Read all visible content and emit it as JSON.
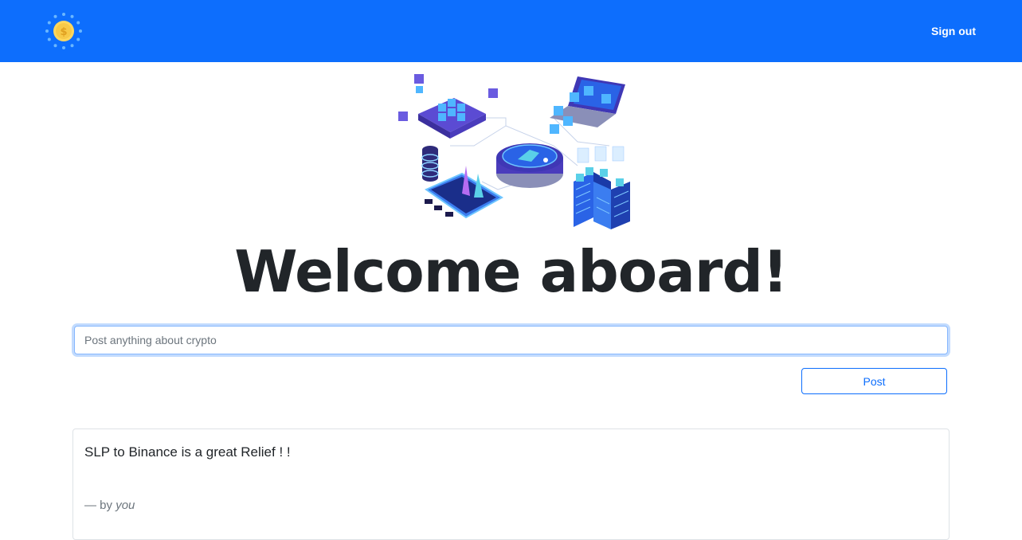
{
  "navbar": {
    "logo_icon": "coin-logo-icon",
    "signout_label": "Sign out",
    "background": "#0d6efd"
  },
  "hero": {
    "image": "blockchain-isometric-illustration",
    "heading": "Welcome aboard!"
  },
  "composer": {
    "placeholder": "Post anything about crypto",
    "value": "",
    "post_label": "Post"
  },
  "posts": [
    {
      "text": "SLP to Binance is a great Relief ! !",
      "byline_prefix": "— by",
      "author": "you"
    }
  ]
}
